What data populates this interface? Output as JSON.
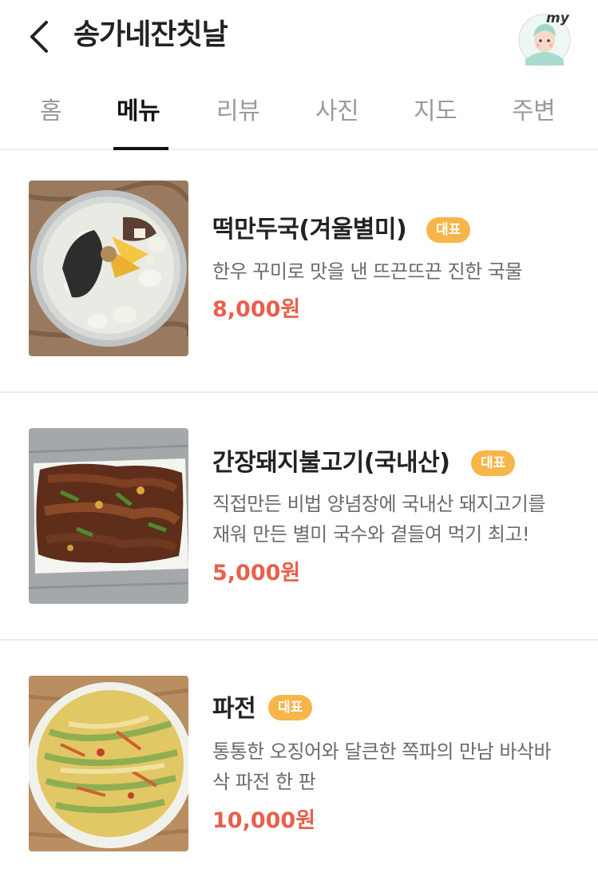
{
  "header": {
    "title": "송가네잔칫날",
    "my_label": "my"
  },
  "tabs": [
    {
      "label": "홈",
      "active": false
    },
    {
      "label": "메뉴",
      "active": true
    },
    {
      "label": "리뷰",
      "active": false
    },
    {
      "label": "사진",
      "active": false
    },
    {
      "label": "지도",
      "active": false
    },
    {
      "label": "주변",
      "active": false
    }
  ],
  "menu": {
    "items": [
      {
        "name": "떡만두국(겨울별미)",
        "badge": "대표",
        "desc_lines": [
          "한우 꾸미로 맛을 낸 뜨끈뜨끈 진한 국물"
        ],
        "price": "8,000원"
      },
      {
        "name": "간장돼지불고기(국내산)",
        "badge": "대표",
        "desc_lines": [
          "직접만든 비법 양념장에 국내산 돼지고기를",
          "재워 만든 별미 국수와 곁들여 먹기 최고!"
        ],
        "price": "5,000원"
      },
      {
        "name": "파전",
        "badge": "대표",
        "desc_lines": [
          "통통한 오징어와 달큰한 쪽파의 만남 바삭바",
          "삭 파전 한 판"
        ],
        "price": "10,000원"
      }
    ]
  },
  "colors": {
    "accent_price": "#e8604c",
    "badge": "#f7b54a",
    "tab_active": "#111111",
    "tab_inactive": "#9a9a9a"
  }
}
